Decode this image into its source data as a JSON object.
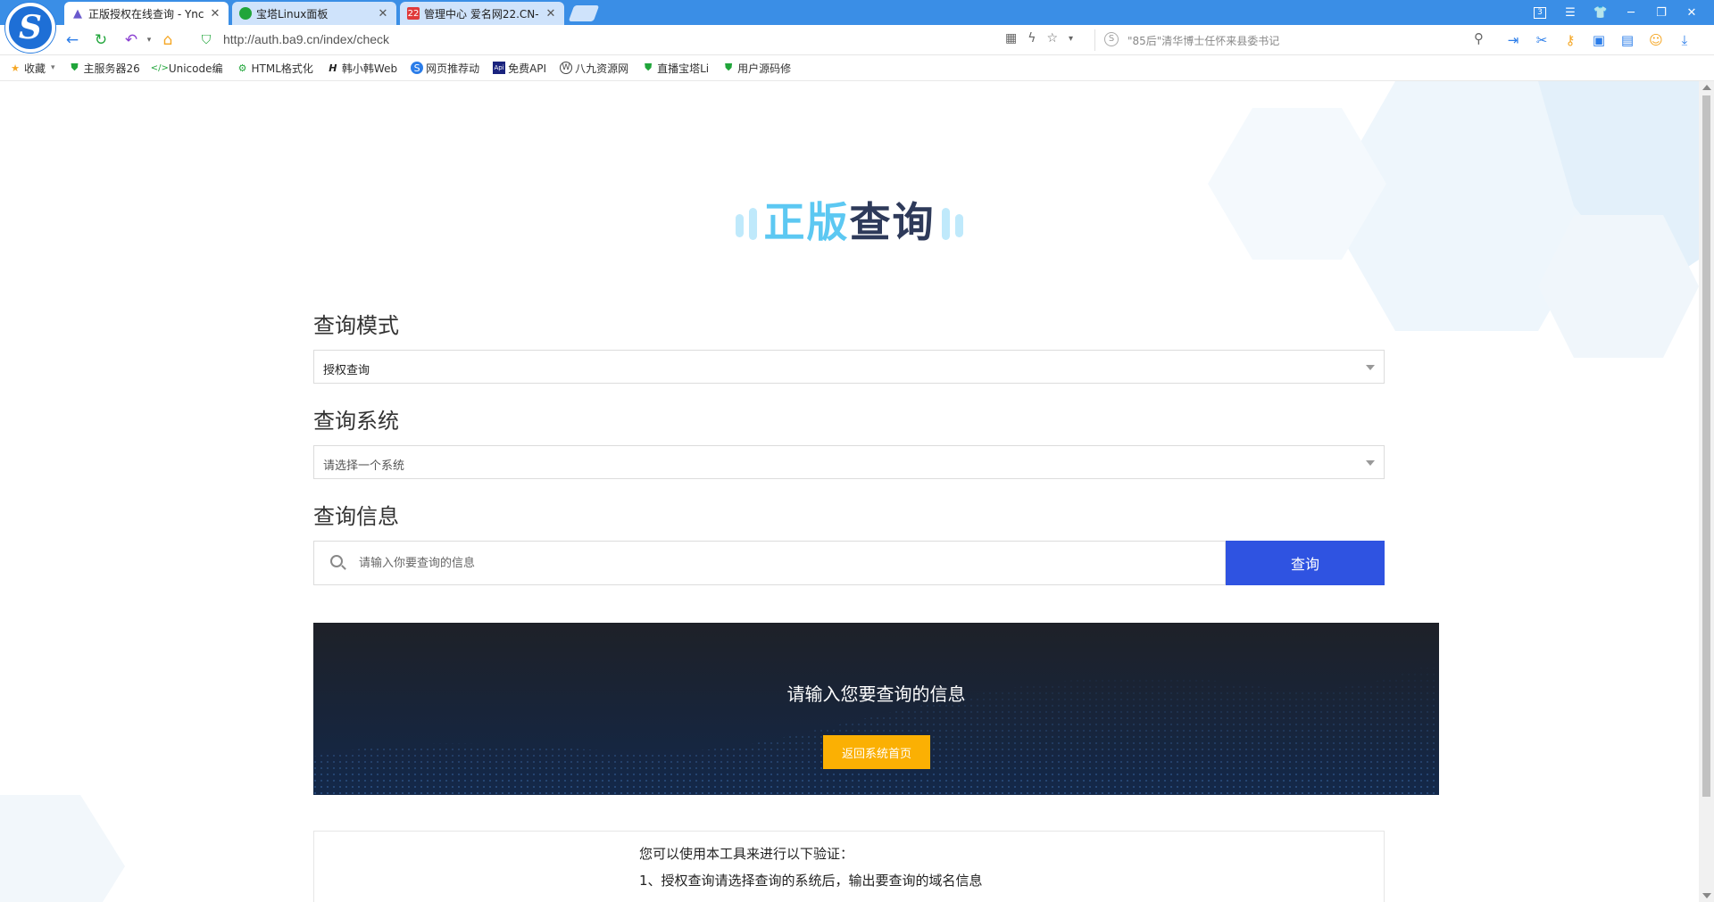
{
  "browser": {
    "tabs": [
      {
        "title": "正版授权在线查询 - Ync",
        "active": true
      },
      {
        "title": "宝塔Linux面板",
        "active": false
      },
      {
        "title": "管理中心 爱名网22.CN-",
        "active": false
      }
    ],
    "tab_badge": "3",
    "address": "http://auth.ba9.cn/index/check",
    "search_placeholder": "\"85后\"清华博士任怀来县委书记",
    "bookmarks": [
      {
        "label": "收藏",
        "icon": "star-icon"
      },
      {
        "label": "主服务器26",
        "icon": "shield-icon"
      },
      {
        "label": "Unicode编",
        "icon": "code-icon"
      },
      {
        "label": "HTML格式化",
        "icon": "gear-icon"
      },
      {
        "label": "韩小韩Web",
        "icon": "h-icon"
      },
      {
        "label": "网页推荐动",
        "icon": "s-icon"
      },
      {
        "label": "免费API",
        "icon": "api-icon"
      },
      {
        "label": "八九资源网",
        "icon": "wordpress-icon"
      },
      {
        "label": "直播宝塔Li",
        "icon": "shield-icon"
      },
      {
        "label": "用户源码修",
        "icon": "shield-icon"
      }
    ]
  },
  "hero": {
    "title_a": "正版",
    "title_b": "查询"
  },
  "form": {
    "mode_label": "查询模式",
    "mode_value": "授权查询",
    "system_label": "查询系统",
    "system_placeholder": "请选择一个系统",
    "info_label": "查询信息",
    "info_placeholder": "请输入你要查询的信息",
    "query_button": "查询"
  },
  "banner": {
    "message": "请输入您要查询的信息",
    "home_button": "返回系统首页"
  },
  "info": {
    "line1": "您可以使用本工具来进行以下验证：",
    "line2": "1、授权查询请选择查询的系统后，输出要查询的域名信息"
  },
  "colors": {
    "accent": "#2f53e1",
    "title_light": "#5cc8f2",
    "title_dark": "#2e3a5a",
    "button_yellow": "#fbb003",
    "tabbar": "#3a8ee6"
  }
}
